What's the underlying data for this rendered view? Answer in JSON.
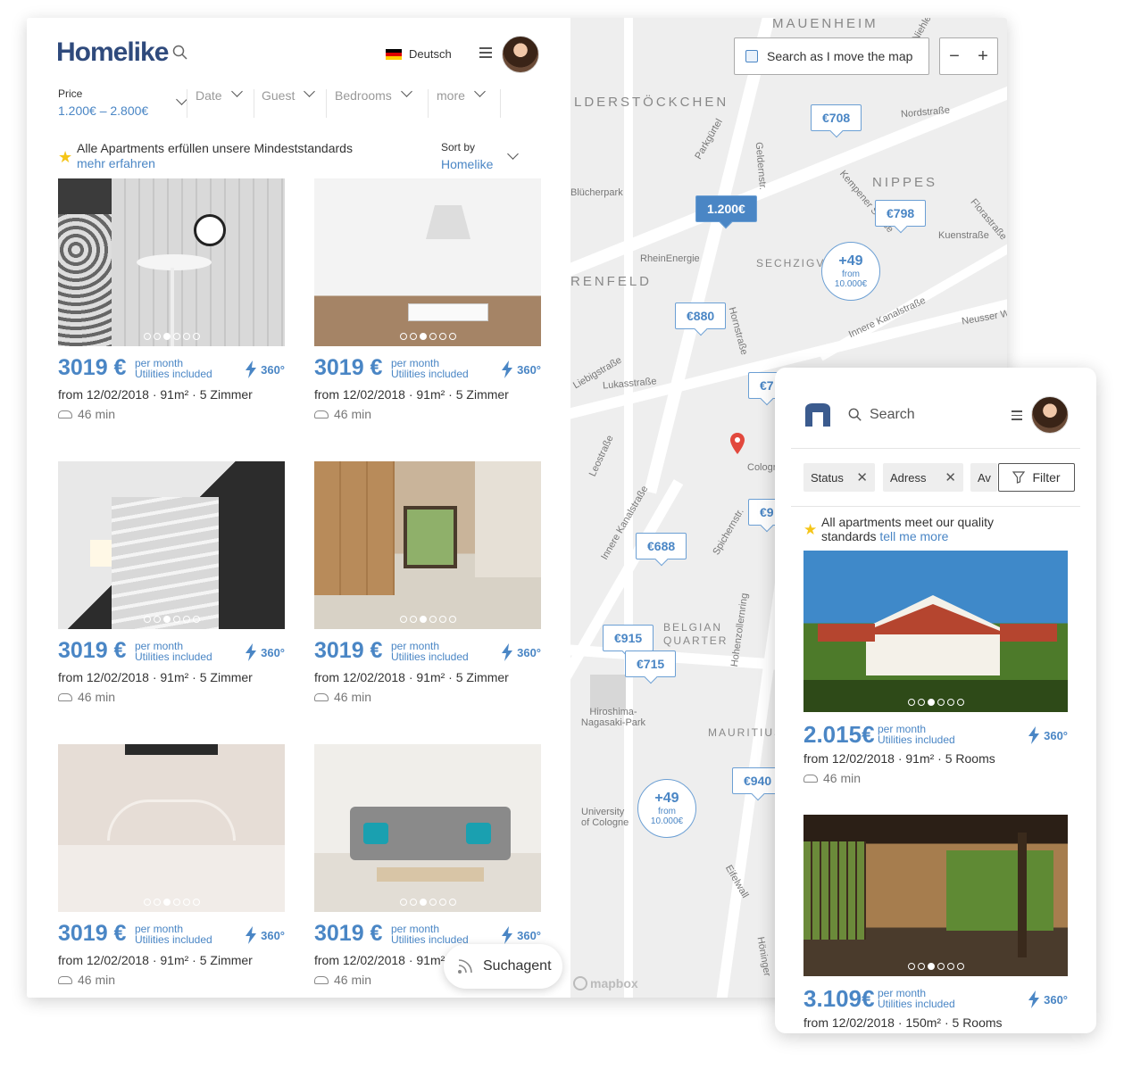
{
  "header": {
    "logo_text": "Homelike",
    "language": "Deutsch"
  },
  "filters": {
    "price_label": "Price",
    "price_value": "1.200€ – 2.800€",
    "date": "Date",
    "guest": "Guest",
    "bedrooms": "Bedrooms",
    "more": "more"
  },
  "notice": {
    "text": "Alle Apartments erfüllen unsere Mindeststandards",
    "link": "mehr erfahren"
  },
  "sort": {
    "label": "Sort by",
    "value": "Homelike"
  },
  "listings": [
    {
      "price": "3019 €",
      "per_month": "per month",
      "utilities": "Utilities included",
      "tour": "360°",
      "meta": "from 12/02/2018 · 91m² · 5 Zimmer",
      "duration": "46 min"
    },
    {
      "price": "3019 €",
      "per_month": "per month",
      "utilities": "Utilities included",
      "tour": "360°",
      "meta": "from 12/02/2018 · 91m² · 5 Zimmer",
      "duration": "46 min"
    },
    {
      "price": "3019 €",
      "per_month": "per month",
      "utilities": "Utilities included",
      "tour": "360°",
      "meta": "from 12/02/2018 · 91m² · 5 Zimmer",
      "duration": "46 min"
    },
    {
      "price": "3019 €",
      "per_month": "per month",
      "utilities": "Utilities included",
      "tour": "360°",
      "meta": "from 12/02/2018 · 91m² · 5 Zimmer",
      "duration": "46 min"
    },
    {
      "price": "3019 €",
      "per_month": "per month",
      "utilities": "Utilities included",
      "tour": "360°",
      "meta": "from 12/02/2018 · 91m² · 5 Zimmer",
      "duration": "46 min"
    },
    {
      "price": "3019 €",
      "per_month": "per month",
      "utilities": "Utilities included",
      "tour": "360°",
      "meta": "from 12/02/2018 · 91m² · 5 Zimmer",
      "duration": "46 min"
    }
  ],
  "suchagent": "Suchagent",
  "map": {
    "search_toggle": "Search as I move the map",
    "zoom_out": "−",
    "zoom_in": "+",
    "districts": [
      "MAUENHEIM",
      "LDERSTÖCKCHEN",
      "NIPPES",
      "SECHZIGV",
      "RENFELD",
      "BELGIAN QUARTER",
      "MAURITIUS"
    ],
    "streets": [
      "Nordstraße",
      "Parkgürtel",
      "Blücherpark",
      "RheinEnergie",
      "Kempener Straße",
      "Florastraße",
      "Kuenstraße",
      "Innere Kanalstraße",
      "Neusser W",
      "Liebigstraße",
      "Lukasstraße",
      "Hornstraße",
      "Leostraße",
      "Innere Kanalstraße",
      "Spichernstr.",
      "Hohenzollernring",
      "Hiroshima-Nagasaki-Park",
      "University of Cologne",
      "Eifelwall",
      "Höninger",
      "Geldernstr.",
      "Niehle",
      "Cologne"
    ],
    "pins": [
      "€708",
      "1.200€",
      "€798",
      "€880",
      "€688",
      "€915",
      "€715",
      "€940",
      "€7",
      "€9"
    ],
    "clusters": [
      {
        "count": "+49",
        "from": "from",
        "amount": "10.000€"
      },
      {
        "count": "+49",
        "from": "from",
        "amount": "10.000€"
      }
    ],
    "attribution": "mapbox"
  },
  "mobile": {
    "search_placeholder": "Search",
    "chips": [
      "Status",
      "Adress",
      "Av"
    ],
    "filter_button": "Filter",
    "notice_text": "All apartments meet our quality standards",
    "notice_link": "tell me more",
    "listings": [
      {
        "price": "2.015€",
        "per_month": "per month",
        "utilities": "Utilities included",
        "tour": "360°",
        "meta": "from 12/02/2018 · 91m² · 5 Rooms",
        "duration": "46 min"
      },
      {
        "price": "3.109€",
        "per_month": "per month",
        "utilities": "Utilities included",
        "tour": "360°",
        "meta": "from 12/02/2018 · 150m² · 5 Rooms"
      }
    ]
  },
  "colors": {
    "brand": "#2f4a7c",
    "accent": "#4a86c5",
    "star": "#f5c518",
    "map_bg": "#eeeeee"
  }
}
